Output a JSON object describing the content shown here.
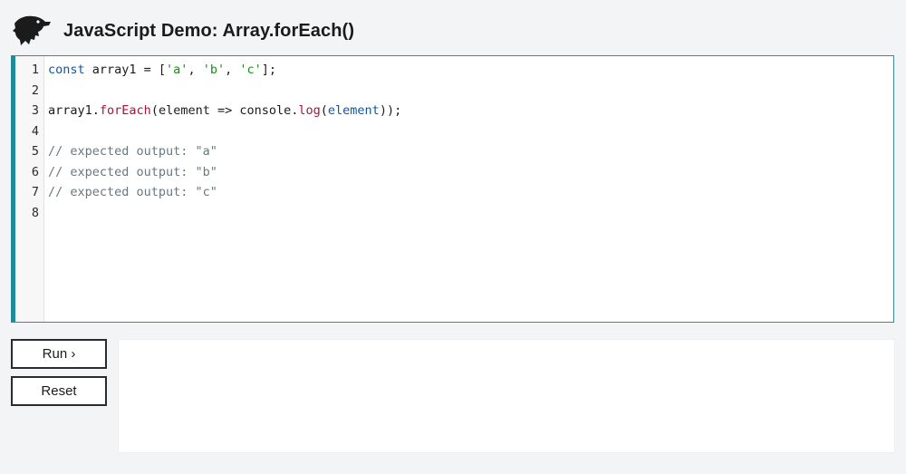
{
  "header": {
    "title": "JavaScript Demo: Array.forEach()",
    "logo_icon": "dinosaur-logo-icon"
  },
  "editor": {
    "line_numbers": [
      "1",
      "2",
      "3",
      "4",
      "5",
      "6",
      "7",
      "8"
    ],
    "lines": [
      [
        {
          "t": "kw",
          "v": "const"
        },
        {
          "t": "plain",
          "v": " array1 = ["
        },
        {
          "t": "str",
          "v": "'a'"
        },
        {
          "t": "plain",
          "v": ", "
        },
        {
          "t": "str",
          "v": "'b'"
        },
        {
          "t": "plain",
          "v": ", "
        },
        {
          "t": "str",
          "v": "'c'"
        },
        {
          "t": "plain",
          "v": "];"
        }
      ],
      [],
      [
        {
          "t": "plain",
          "v": "array1."
        },
        {
          "t": "fn",
          "v": "forEach"
        },
        {
          "t": "plain",
          "v": "(element => console."
        },
        {
          "t": "fn",
          "v": "log"
        },
        {
          "t": "plain",
          "v": "("
        },
        {
          "t": "var",
          "v": "element"
        },
        {
          "t": "plain",
          "v": "));"
        }
      ],
      [],
      [
        {
          "t": "cm",
          "v": "// expected output: \"a\""
        }
      ],
      [
        {
          "t": "cm",
          "v": "// expected output: \"b\""
        }
      ],
      [
        {
          "t": "cm",
          "v": "// expected output: \"c\""
        }
      ],
      []
    ],
    "colors": {
      "keyword": "#0f56a3",
      "string": "#1b8a1b",
      "function": "#a8143b",
      "comment": "#697780",
      "accent_border": "#1f8a9a"
    }
  },
  "controls": {
    "run_label": "Run ›",
    "reset_label": "Reset"
  },
  "output": {
    "text": ""
  }
}
